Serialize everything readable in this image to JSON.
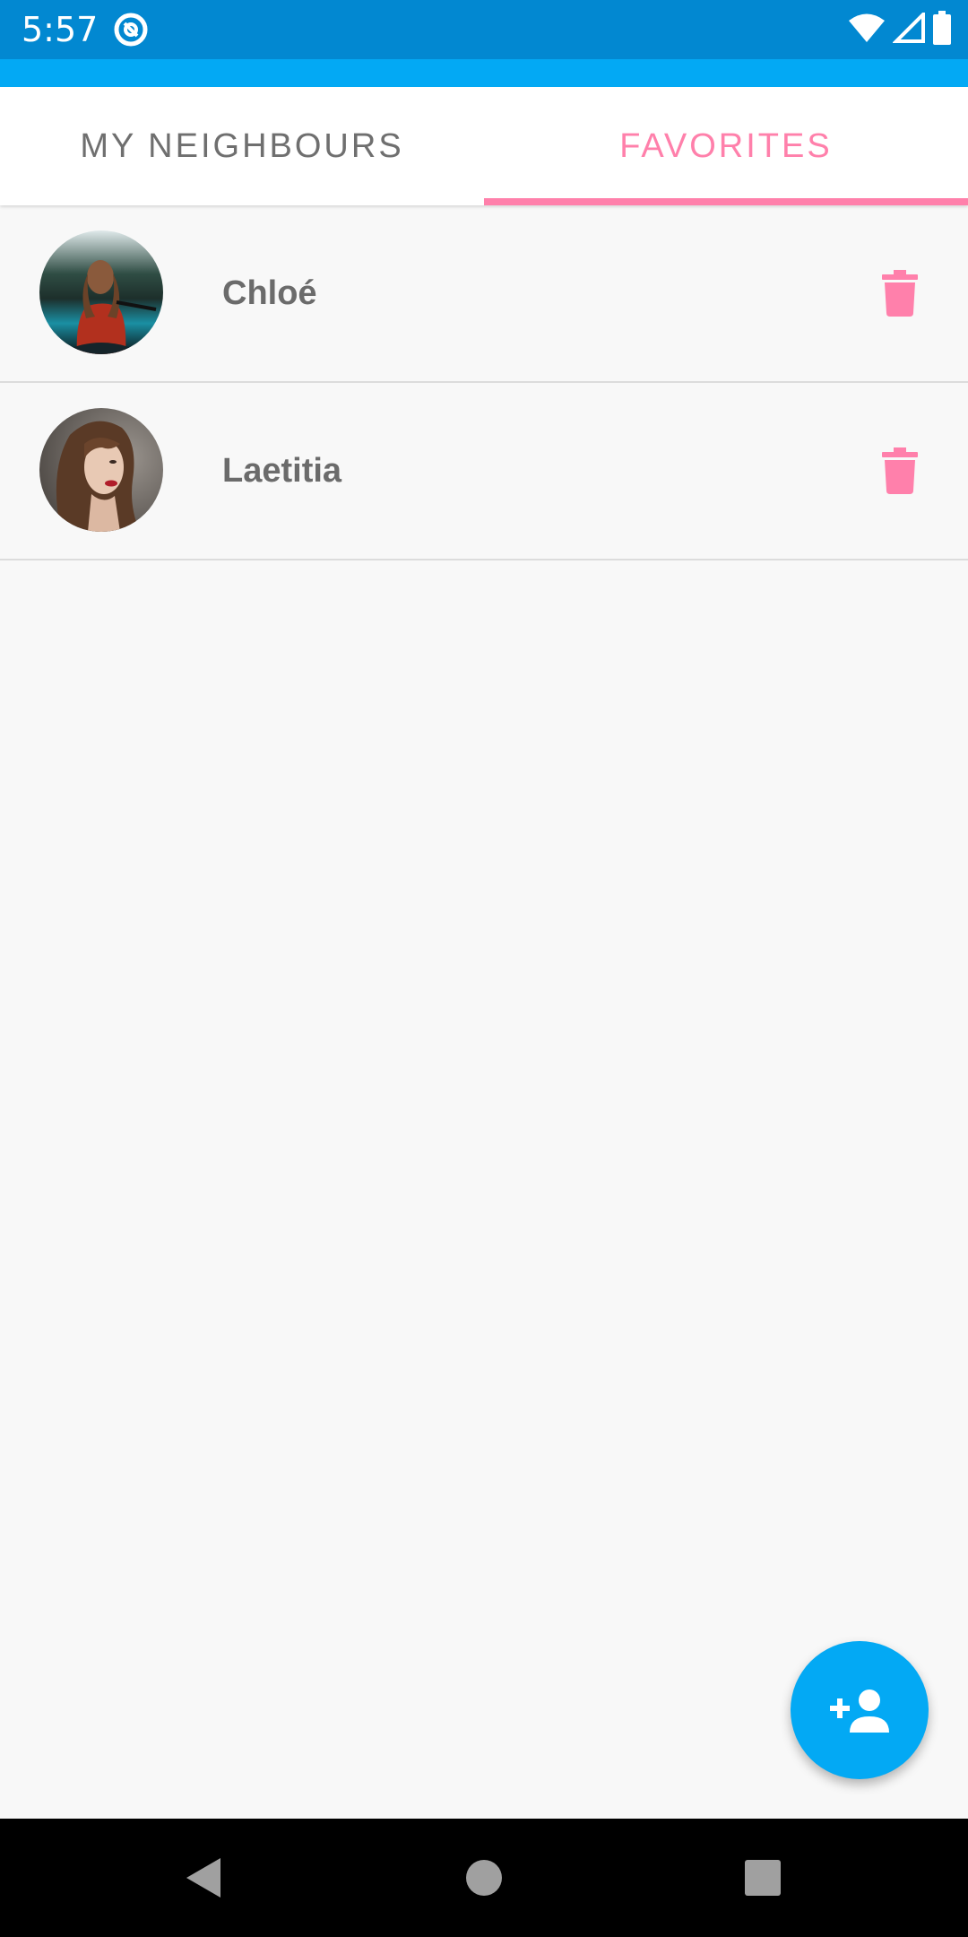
{
  "status_bar": {
    "time": "5:57",
    "background": "#0288d1"
  },
  "colors": {
    "primary": "#03a9f4",
    "accent": "#ff80ab",
    "text_secondary": "#6b6b6b"
  },
  "tabs": [
    {
      "label": "MY NEIGHBOURS",
      "selected": false
    },
    {
      "label": "FAVORITES",
      "selected": true
    }
  ],
  "favorites": [
    {
      "name": "Chloé",
      "avatar_icon": "avatar-photo",
      "action_icon": "trash-icon"
    },
    {
      "name": "Laetitia",
      "avatar_icon": "avatar-photo",
      "action_icon": "trash-icon"
    }
  ],
  "fab": {
    "icon": "add-person-icon"
  },
  "nav_bar": {
    "icons": [
      "back-icon",
      "home-icon",
      "recents-icon"
    ]
  }
}
